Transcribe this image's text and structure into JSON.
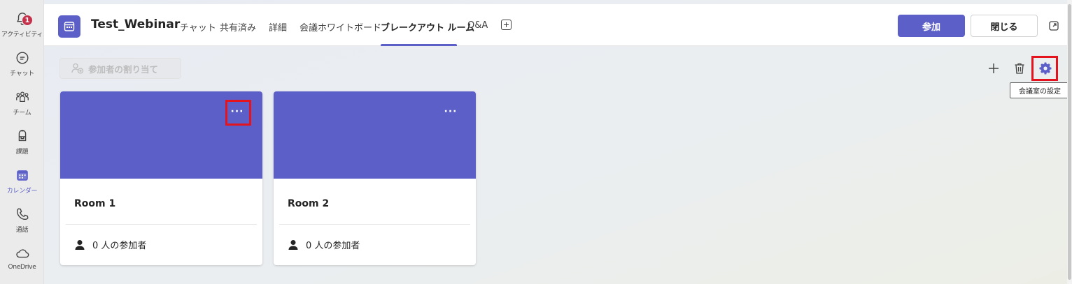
{
  "rail": {
    "items": [
      {
        "label": "アクティビティ",
        "icon": "bell-icon",
        "badge": "1"
      },
      {
        "label": "チャット",
        "icon": "chat-icon"
      },
      {
        "label": "チーム",
        "icon": "teams-icon"
      },
      {
        "label": "課題",
        "icon": "backpack-icon"
      },
      {
        "label": "カレンダー",
        "icon": "calendar-icon",
        "active": true
      },
      {
        "label": "通話",
        "icon": "phone-icon"
      },
      {
        "label": "OneDrive",
        "icon": "cloud-icon"
      }
    ]
  },
  "header": {
    "title": "Test_Webinar",
    "tabs": [
      {
        "label": "チャット"
      },
      {
        "label": "共有済み"
      },
      {
        "label": "詳細"
      },
      {
        "label": "会議ホワイトボード"
      },
      {
        "label": "ブレークアウト ルーム",
        "active": true
      },
      {
        "label": "Q&A"
      }
    ],
    "join_label": "参加",
    "close_label": "閉じる"
  },
  "toolbar": {
    "assign_label": "参加者の割り当て",
    "tooltip": "会議室の設定"
  },
  "rooms": [
    {
      "name": "Room 1",
      "participants": "0 人の参加者"
    },
    {
      "name": "Room 2",
      "participants": "0 人の参加者"
    }
  ],
  "colors": {
    "accent": "#5b5fc7",
    "highlight": "#e3141d",
    "badge": "#c4314b"
  }
}
